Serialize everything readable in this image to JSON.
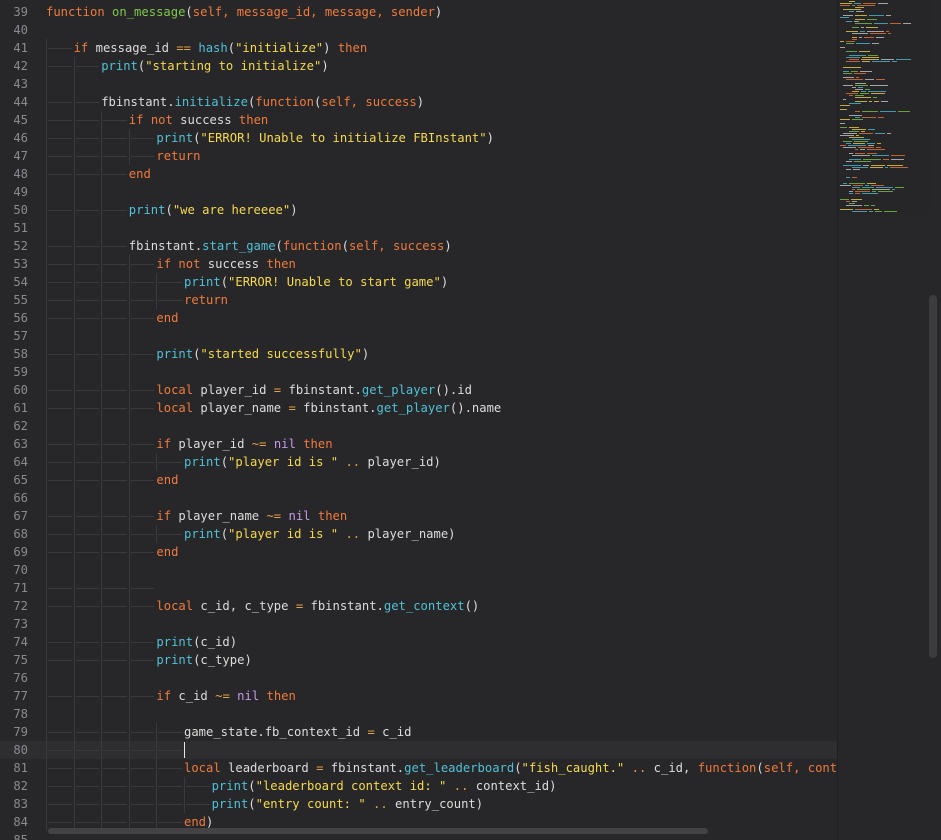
{
  "editor": {
    "lines": [
      {
        "n": "39",
        "indent": 0,
        "tokens": [
          [
            "kw",
            "function"
          ],
          [
            "text",
            " "
          ],
          [
            "fn",
            "on_message"
          ],
          [
            "text",
            "("
          ],
          [
            "param",
            "self, message_id, message, sender"
          ],
          [
            "text",
            ")"
          ]
        ]
      },
      {
        "n": "40",
        "indent": 0,
        "tokens": []
      },
      {
        "n": "41",
        "indent": 1,
        "tokens": [
          [
            "kw",
            "if"
          ],
          [
            "text",
            " message_id "
          ],
          [
            "op",
            "=="
          ],
          [
            "text",
            " "
          ],
          [
            "builtin",
            "hash"
          ],
          [
            "text",
            "("
          ],
          [
            "str",
            "\"initialize\""
          ],
          [
            "text",
            ") "
          ],
          [
            "kw",
            "then"
          ]
        ]
      },
      {
        "n": "42",
        "indent": 2,
        "tokens": [
          [
            "builtin",
            "print"
          ],
          [
            "text",
            "("
          ],
          [
            "str",
            "\"starting to initialize\""
          ],
          [
            "text",
            ")"
          ]
        ]
      },
      {
        "n": "43",
        "indent": 0,
        "tokens": []
      },
      {
        "n": "44",
        "indent": 2,
        "tokens": [
          [
            "text",
            "fbinstant."
          ],
          [
            "builtin",
            "initialize"
          ],
          [
            "text",
            "("
          ],
          [
            "kw",
            "function"
          ],
          [
            "text",
            "("
          ],
          [
            "param",
            "self, success"
          ],
          [
            "text",
            ")"
          ]
        ]
      },
      {
        "n": "45",
        "indent": 3,
        "tokens": [
          [
            "kw",
            "if"
          ],
          [
            "text",
            " "
          ],
          [
            "kw",
            "not"
          ],
          [
            "text",
            " success "
          ],
          [
            "kw",
            "then"
          ]
        ]
      },
      {
        "n": "46",
        "indent": 4,
        "tokens": [
          [
            "builtin",
            "print"
          ],
          [
            "text",
            "("
          ],
          [
            "str",
            "\"ERROR! Unable to initialize FBInstant\""
          ],
          [
            "text",
            ")"
          ]
        ]
      },
      {
        "n": "47",
        "indent": 4,
        "tokens": [
          [
            "kw",
            "return"
          ]
        ]
      },
      {
        "n": "48",
        "indent": 3,
        "tokens": [
          [
            "kw",
            "end"
          ]
        ]
      },
      {
        "n": "49",
        "indent": 0,
        "tokens": []
      },
      {
        "n": "50",
        "indent": 3,
        "tokens": [
          [
            "builtin",
            "print"
          ],
          [
            "text",
            "("
          ],
          [
            "str",
            "\"we are hereeee\""
          ],
          [
            "text",
            ")"
          ]
        ]
      },
      {
        "n": "51",
        "indent": 0,
        "tokens": []
      },
      {
        "n": "52",
        "indent": 3,
        "tokens": [
          [
            "text",
            "fbinstant."
          ],
          [
            "builtin",
            "start_game"
          ],
          [
            "text",
            "("
          ],
          [
            "kw",
            "function"
          ],
          [
            "text",
            "("
          ],
          [
            "param",
            "self, success"
          ],
          [
            "text",
            ")"
          ]
        ]
      },
      {
        "n": "53",
        "indent": 4,
        "tokens": [
          [
            "kw",
            "if"
          ],
          [
            "text",
            " "
          ],
          [
            "kw",
            "not"
          ],
          [
            "text",
            " success "
          ],
          [
            "kw",
            "then"
          ]
        ]
      },
      {
        "n": "54",
        "indent": 5,
        "tokens": [
          [
            "builtin",
            "print"
          ],
          [
            "text",
            "("
          ],
          [
            "str",
            "\"ERROR! Unable to start game\""
          ],
          [
            "text",
            ")"
          ]
        ]
      },
      {
        "n": "55",
        "indent": 5,
        "tokens": [
          [
            "kw",
            "return"
          ]
        ]
      },
      {
        "n": "56",
        "indent": 4,
        "tokens": [
          [
            "kw",
            "end"
          ]
        ]
      },
      {
        "n": "57",
        "indent": 0,
        "tokens": []
      },
      {
        "n": "58",
        "indent": 4,
        "tokens": [
          [
            "builtin",
            "print"
          ],
          [
            "text",
            "("
          ],
          [
            "str",
            "\"started successfully\""
          ],
          [
            "text",
            ")"
          ]
        ]
      },
      {
        "n": "59",
        "indent": 0,
        "tokens": []
      },
      {
        "n": "60",
        "indent": 4,
        "tokens": [
          [
            "kw",
            "local"
          ],
          [
            "text",
            " player_id "
          ],
          [
            "op",
            "="
          ],
          [
            "text",
            " fbinstant."
          ],
          [
            "builtin",
            "get_player"
          ],
          [
            "text",
            "().id"
          ]
        ]
      },
      {
        "n": "61",
        "indent": 4,
        "tokens": [
          [
            "kw",
            "local"
          ],
          [
            "text",
            " player_name "
          ],
          [
            "op",
            "="
          ],
          [
            "text",
            " fbinstant."
          ],
          [
            "builtin",
            "get_player"
          ],
          [
            "text",
            "().name"
          ]
        ]
      },
      {
        "n": "62",
        "indent": 0,
        "tokens": []
      },
      {
        "n": "63",
        "indent": 4,
        "tokens": [
          [
            "kw",
            "if"
          ],
          [
            "text",
            " player_id "
          ],
          [
            "op",
            "~="
          ],
          [
            "text",
            " "
          ],
          [
            "nil",
            "nil"
          ],
          [
            "text",
            " "
          ],
          [
            "kw",
            "then"
          ]
        ]
      },
      {
        "n": "64",
        "indent": 5,
        "tokens": [
          [
            "builtin",
            "print"
          ],
          [
            "text",
            "("
          ],
          [
            "str",
            "\"player id is \""
          ],
          [
            "text",
            " "
          ],
          [
            "op",
            ".."
          ],
          [
            "text",
            " player_id)"
          ]
        ]
      },
      {
        "n": "65",
        "indent": 4,
        "tokens": [
          [
            "kw",
            "end"
          ]
        ]
      },
      {
        "n": "66",
        "indent": 0,
        "tokens": []
      },
      {
        "n": "67",
        "indent": 4,
        "tokens": [
          [
            "kw",
            "if"
          ],
          [
            "text",
            " player_name "
          ],
          [
            "op",
            "~="
          ],
          [
            "text",
            " "
          ],
          [
            "nil",
            "nil"
          ],
          [
            "text",
            " "
          ],
          [
            "kw",
            "then"
          ]
        ]
      },
      {
        "n": "68",
        "indent": 5,
        "tokens": [
          [
            "builtin",
            "print"
          ],
          [
            "text",
            "("
          ],
          [
            "str",
            "\"player id is \""
          ],
          [
            "text",
            " "
          ],
          [
            "op",
            ".."
          ],
          [
            "text",
            " player_name)"
          ]
        ]
      },
      {
        "n": "69",
        "indent": 4,
        "tokens": [
          [
            "kw",
            "end"
          ]
        ]
      },
      {
        "n": "70",
        "indent": 0,
        "tokens": []
      },
      {
        "n": "71",
        "indent": 4,
        "tokens": [],
        "ws": true
      },
      {
        "n": "72",
        "indent": 4,
        "tokens": [
          [
            "kw",
            "local"
          ],
          [
            "text",
            " c_id, c_type "
          ],
          [
            "op",
            "="
          ],
          [
            "text",
            " fbinstant."
          ],
          [
            "builtin",
            "get_context"
          ],
          [
            "text",
            "()"
          ]
        ]
      },
      {
        "n": "73",
        "indent": 0,
        "tokens": []
      },
      {
        "n": "74",
        "indent": 4,
        "tokens": [
          [
            "builtin",
            "print"
          ],
          [
            "text",
            "(c_id)"
          ]
        ]
      },
      {
        "n": "75",
        "indent": 4,
        "tokens": [
          [
            "builtin",
            "print"
          ],
          [
            "text",
            "(c_type)"
          ]
        ]
      },
      {
        "n": "76",
        "indent": 0,
        "tokens": []
      },
      {
        "n": "77",
        "indent": 4,
        "tokens": [
          [
            "kw",
            "if"
          ],
          [
            "text",
            " c_id "
          ],
          [
            "op",
            "~="
          ],
          [
            "text",
            " "
          ],
          [
            "nil",
            "nil"
          ],
          [
            "text",
            " "
          ],
          [
            "kw",
            "then"
          ]
        ]
      },
      {
        "n": "78",
        "indent": 0,
        "tokens": []
      },
      {
        "n": "79",
        "indent": 5,
        "tokens": [
          [
            "text",
            "game_state.fb_context_id "
          ],
          [
            "op",
            "="
          ],
          [
            "text",
            " c_id"
          ]
        ]
      },
      {
        "n": "80",
        "indent": 5,
        "tokens": [],
        "cursor": true,
        "current": true
      },
      {
        "n": "81",
        "indent": 5,
        "tokens": [
          [
            "kw",
            "local"
          ],
          [
            "text",
            " leaderboard "
          ],
          [
            "op",
            "="
          ],
          [
            "text",
            " fbinstant."
          ],
          [
            "builtin",
            "get_leaderboard"
          ],
          [
            "text",
            "("
          ],
          [
            "str",
            "\"fish_caught.\""
          ],
          [
            "text",
            " "
          ],
          [
            "op",
            ".."
          ],
          [
            "text",
            " c_id, "
          ],
          [
            "kw",
            "function"
          ],
          [
            "text",
            "("
          ],
          [
            "param",
            "self, context_i"
          ]
        ]
      },
      {
        "n": "82",
        "indent": 6,
        "tokens": [
          [
            "builtin",
            "print"
          ],
          [
            "text",
            "("
          ],
          [
            "str",
            "\"leaderboard context id: \""
          ],
          [
            "text",
            " "
          ],
          [
            "op",
            ".."
          ],
          [
            "text",
            " context_id)"
          ]
        ]
      },
      {
        "n": "83",
        "indent": 6,
        "tokens": [
          [
            "builtin",
            "print"
          ],
          [
            "text",
            "("
          ],
          [
            "str",
            "\"entry count: \""
          ],
          [
            "text",
            " "
          ],
          [
            "op",
            ".."
          ],
          [
            "text",
            " entry_count)"
          ]
        ]
      },
      {
        "n": "84",
        "indent": 5,
        "tokens": [
          [
            "kw",
            "end"
          ],
          [
            "text",
            ")"
          ]
        ]
      },
      {
        "n": "85",
        "indent": 0,
        "tokens": []
      }
    ]
  },
  "colors": {
    "background": "#272729",
    "keyword": "#f07a3c",
    "function_name": "#7ec84a",
    "string": "#f5d94e",
    "builtin": "#4fc1d6",
    "nil": "#c49ae8"
  }
}
